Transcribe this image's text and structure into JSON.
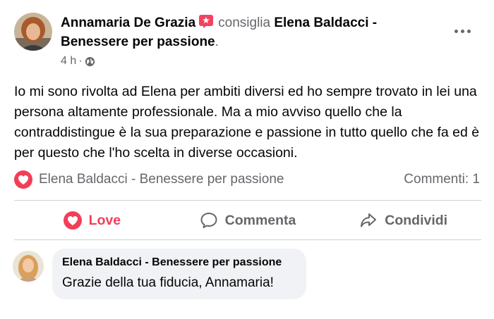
{
  "post": {
    "author": "Annamaria De Grazia",
    "verb": "consiglia",
    "page": "Elena Baldacci - Benessere per passione",
    "page_end": ".",
    "time": "4 h",
    "separator": "·",
    "text": "Io mi sono rivolta ad Elena per ambiti diversi ed ho sempre trovato in lei una persona altamente professionale. Ma a mio avviso quello che la contraddistingue è la sua preparazione e passione in tutto quello che fa ed è per questo che l'ho scelta in diverse occasioni.",
    "icons": {
      "recommend": "recommend-star-icon",
      "audience": "globe-icon",
      "more": "more-options-icon"
    }
  },
  "reactions": {
    "names": "Elena Baldacci - Benessere per passione",
    "comments": "Commenti: 1",
    "icon": "heart-reaction-icon"
  },
  "actions": {
    "love": "Love",
    "comment": "Commenta",
    "share": "Condividi"
  },
  "reply": {
    "name": "Elena Baldacci - Benessere per passione",
    "text": "Grazie della tua fiducia, Annamaria!"
  },
  "colors": {
    "love": "#f33e58",
    "secondary_text": "#65676b",
    "bubble": "#f0f2f5",
    "divider": "#ced0d4"
  }
}
